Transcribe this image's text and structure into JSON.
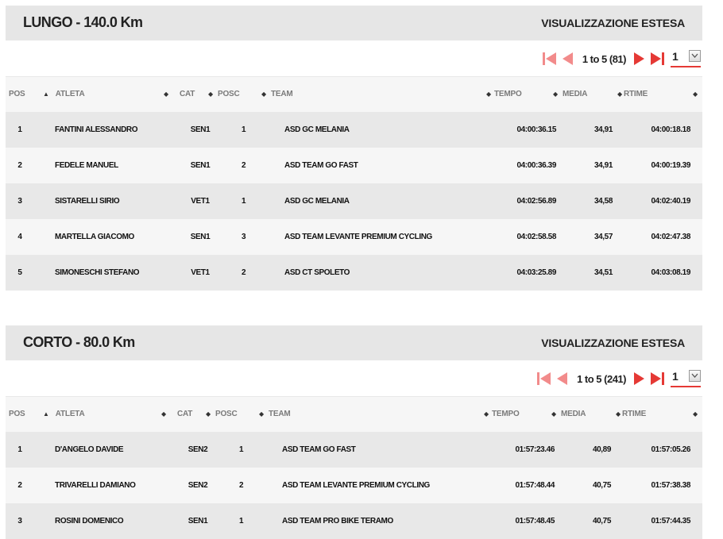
{
  "pager_colors": {
    "accent": "#e53935",
    "soft": "#f28b8b"
  },
  "columns": [
    "POS",
    "ATLETA",
    "CAT",
    "POSC",
    "TEAM",
    "TEMPO",
    "MEDIA",
    "RTIME"
  ],
  "sections": [
    {
      "title": "LUNGO - 140.0 Km",
      "extended_link": "VISUALIZZAZIONE ESTESA",
      "pager_text": "1 to 5 (81)",
      "page_select": "1",
      "rows": [
        {
          "pos": "1",
          "atleta": "FANTINI ALESSANDRO",
          "cat": "SEN1",
          "posc": "1",
          "team": "ASD GC MELANIA",
          "tempo": "04:00:36.15",
          "media": "34,91",
          "rtime": "04:00:18.18"
        },
        {
          "pos": "2",
          "atleta": "FEDELE MANUEL",
          "cat": "SEN1",
          "posc": "2",
          "team": "ASD TEAM GO FAST",
          "tempo": "04:00:36.39",
          "media": "34,91",
          "rtime": "04:00:19.39"
        },
        {
          "pos": "3",
          "atleta": "SISTARELLI SIRIO",
          "cat": "VET1",
          "posc": "1",
          "team": "ASD GC MELANIA",
          "tempo": "04:02:56.89",
          "media": "34,58",
          "rtime": "04:02:40.19"
        },
        {
          "pos": "4",
          "atleta": "MARTELLA GIACOMO",
          "cat": "SEN1",
          "posc": "3",
          "team": "ASD TEAM LEVANTE PREMIUM CYCLING",
          "tempo": "04:02:58.58",
          "media": "34,57",
          "rtime": "04:02:47.38"
        },
        {
          "pos": "5",
          "atleta": "SIMONESCHI STEFANO",
          "cat": "VET1",
          "posc": "2",
          "team": "ASD CT SPOLETO",
          "tempo": "04:03:25.89",
          "media": "34,51",
          "rtime": "04:03:08.19"
        }
      ]
    },
    {
      "title": "CORTO - 80.0 Km",
      "extended_link": "VISUALIZZAZIONE ESTESA",
      "pager_text": "1 to 5 (241)",
      "page_select": "1",
      "rows": [
        {
          "pos": "1",
          "atleta": "D'ANGELO DAVIDE",
          "cat": "SEN2",
          "posc": "1",
          "team": "ASD TEAM GO FAST",
          "tempo": "01:57:23.46",
          "media": "40,89",
          "rtime": "01:57:05.26"
        },
        {
          "pos": "2",
          "atleta": "TRIVARELLI DAMIANO",
          "cat": "SEN2",
          "posc": "2",
          "team": "ASD TEAM LEVANTE PREMIUM CYCLING",
          "tempo": "01:57:48.44",
          "media": "40,75",
          "rtime": "01:57:38.38"
        },
        {
          "pos": "3",
          "atleta": "ROSINI DOMENICO",
          "cat": "SEN1",
          "posc": "1",
          "team": "ASD TEAM PRO BIKE TERAMO",
          "tempo": "01:57:48.45",
          "media": "40,75",
          "rtime": "01:57:44.35"
        }
      ]
    }
  ]
}
